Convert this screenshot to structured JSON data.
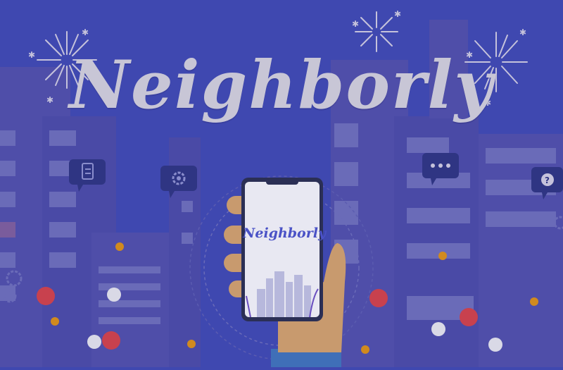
{
  "brand": {
    "title": "Neighborly",
    "phone_logo": "Neighborly"
  },
  "colors": {
    "background": "#3f48b0",
    "building": "#4f4ea9",
    "building_dark": "#4747a4",
    "window": "#6a6bb8",
    "title_text": "#c8c6d6",
    "phone_logo": "#4a52c6",
    "hand": "#c89a6e",
    "sleeve": "#3f6fb8",
    "dot_red": "#c8414e",
    "dot_orange": "#d18a1e",
    "dot_white": "#d9d9e6",
    "bubble": "#2f3583"
  },
  "icons": [
    "firework-icon",
    "clipboard-icon",
    "gear-icon",
    "chat-dots-icon",
    "question-icon",
    "phone-icon",
    "hand-icon"
  ]
}
